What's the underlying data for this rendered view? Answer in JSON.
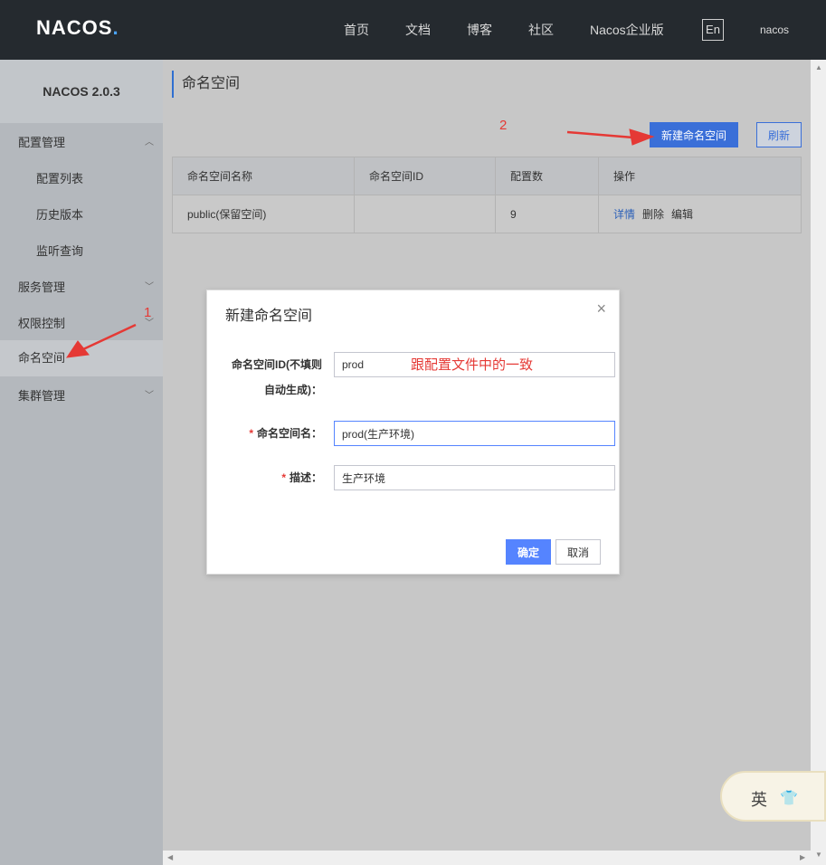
{
  "header": {
    "logo_main": "NACOS",
    "logo_dot": ".",
    "nav": [
      "首页",
      "文档",
      "博客",
      "社区",
      "Nacos企业版"
    ],
    "lang": "En",
    "user": "nacos"
  },
  "sidebar": {
    "title": "NACOS 2.0.3",
    "items": [
      {
        "label": "配置管理",
        "chevron": "^"
      },
      {
        "label": "配置列表"
      },
      {
        "label": "历史版本"
      },
      {
        "label": "监听查询"
      },
      {
        "label": "服务管理",
        "chevron": "v"
      },
      {
        "label": "权限控制",
        "chevron": "v"
      },
      {
        "label": "命名空间"
      },
      {
        "label": "集群管理",
        "chevron": "v"
      }
    ]
  },
  "main": {
    "title": "命名空间",
    "new_button": "新建命名空间",
    "refresh_button": "刷新",
    "table": {
      "headers": [
        "命名空间名称",
        "命名空间ID",
        "配置数",
        "操作"
      ],
      "rows": [
        {
          "name": "public(保留空间)",
          "id": "",
          "count": "9",
          "ops": [
            "详情",
            "删除",
            "编辑"
          ]
        }
      ]
    }
  },
  "annotations": {
    "one": "1",
    "two": "2"
  },
  "modal": {
    "title": "新建命名空间",
    "close": "×",
    "id_label_1": "命名空间ID(不填则",
    "id_label_2": "自动生成)：",
    "id_value": "prod",
    "id_hint": "跟配置文件中的一致",
    "name_required": "*",
    "name_label": "命名空间名：",
    "name_value": "prod(生产环境)",
    "desc_required": "*",
    "desc_label": "描述：",
    "desc_value": "生产环境",
    "ok": "确定",
    "cancel": "取消"
  },
  "ime": {
    "text": "英"
  },
  "colors": {
    "accent": "#3a6fd8",
    "annotation": "#e53935",
    "header_bg": "#252a2f"
  }
}
